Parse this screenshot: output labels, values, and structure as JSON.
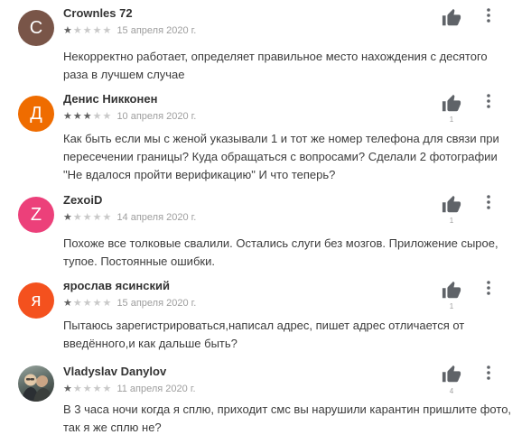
{
  "colors": {
    "star_on": "#616161",
    "star_off": "#c9c9c9",
    "meta_text": "#9e9e9e"
  },
  "icons": {
    "like": "thumbs-up-icon",
    "more": "more-vert-icon"
  },
  "reviews": [
    {
      "name": "Crownles 72",
      "avatar_letter": "C",
      "avatar_color": "#795548",
      "rating": 1,
      "date": "15 апреля 2020 г.",
      "text": "Некорректно работает, определяет правильное место нахождения с десятого раза в лучшем случае",
      "likes": ""
    },
    {
      "name": "Денис Никконен",
      "avatar_letter": "Д",
      "avatar_color": "#ef6c00",
      "rating": 3,
      "date": "10 апреля 2020 г.",
      "text": "Как быть если мы с женой указывали 1 и тот же номер телефона для связи при пересечении границы? Куда обращаться с вопросами? Сделали 2 фотографии \"Не вдалося пройти верификацию\" И что теперь?",
      "likes": "1"
    },
    {
      "name": "ZexoiD",
      "avatar_letter": "Z",
      "avatar_color": "#ec407a",
      "rating": 1,
      "date": "14 апреля 2020 г.",
      "text": "Похоже все толковые свалили. Остались слуги без мозгов. Приложение сырое, тупое. Постоянные ошибки.",
      "likes": "1"
    },
    {
      "name": "ярослав ясинский",
      "avatar_letter": "я",
      "avatar_color": "#f4511e",
      "rating": 1,
      "date": "15 апреля 2020 г.",
      "text": "Пытаюсь зарегистрироваться,написал адрес, пишет адрес отличается от введённого,и как дальше быть?",
      "likes": "1"
    },
    {
      "name": "Vladyslav Danylov",
      "avatar_letter": "",
      "avatar_color": "",
      "rating": 1,
      "date": "11 апреля 2020 г.",
      "text": "В 3 часа ночи когда я сплю, приходит смс вы нарушили карантин пришлите фото, так я же сплю не?",
      "likes": "4"
    }
  ]
}
